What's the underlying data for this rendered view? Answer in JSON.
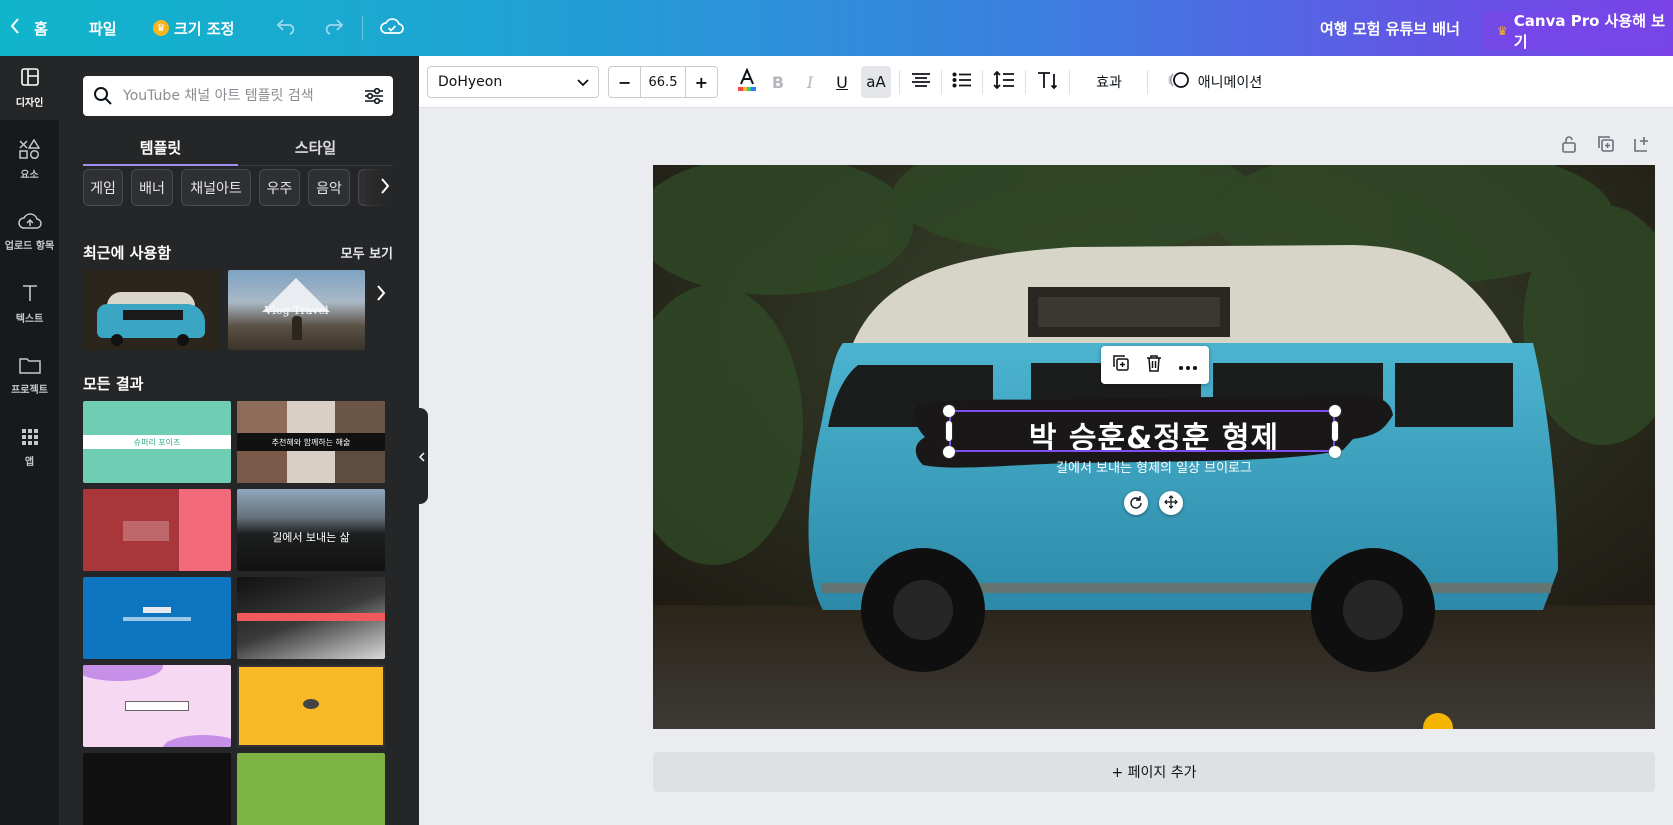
{
  "topbar": {
    "home_label": "홈",
    "file_label": "파일",
    "resize_label": "크기 조정",
    "doc_title": "여행 모험 유튜브 배너",
    "pro_label": "Canva Pro 사용해 보기"
  },
  "rail": {
    "items": [
      {
        "label": "디자인",
        "icon": "layout-icon"
      },
      {
        "label": "요소",
        "icon": "shapes-icon"
      },
      {
        "label": "업로드 항목",
        "icon": "cloud-upload-icon"
      },
      {
        "label": "텍스트",
        "icon": "text-icon"
      },
      {
        "label": "프로젝트",
        "icon": "folder-icon"
      },
      {
        "label": "앱",
        "icon": "apps-grid-icon"
      }
    ]
  },
  "panel": {
    "search_placeholder": "YouTube 채널 아트 템플릿 검색",
    "tab_templates": "템플릿",
    "tab_styles": "스타일",
    "chips": [
      "게임",
      "배너",
      "채널아트",
      "우주",
      "음악"
    ],
    "recent_title": "최근에 사용함",
    "see_all": "모두 보기",
    "recent_thumb2_text": "Vlog Travel",
    "all_results_title": "모든 결과",
    "thumbs": {
      "t1": "슈퍼리 포이즈",
      "t2": "추천해와 함께하는 해술",
      "t4": "길에서 보내는 삶"
    }
  },
  "toolbar": {
    "font_name": "DoHyeon",
    "font_size": "66.5",
    "minus": "−",
    "plus": "+",
    "effects_label": "효과",
    "animate_label": "애니메이션",
    "case_label": "aA"
  },
  "canvas": {
    "title": "박 승훈&정훈 형제",
    "subtitle": "길에서 보내는 형제의 일상 브이로그",
    "add_page": "+ 페이지 추가"
  },
  "colors": {
    "accent": "#8b3dff",
    "selection": "#7d4ff0",
    "van_blue": "#3aa6c4"
  }
}
